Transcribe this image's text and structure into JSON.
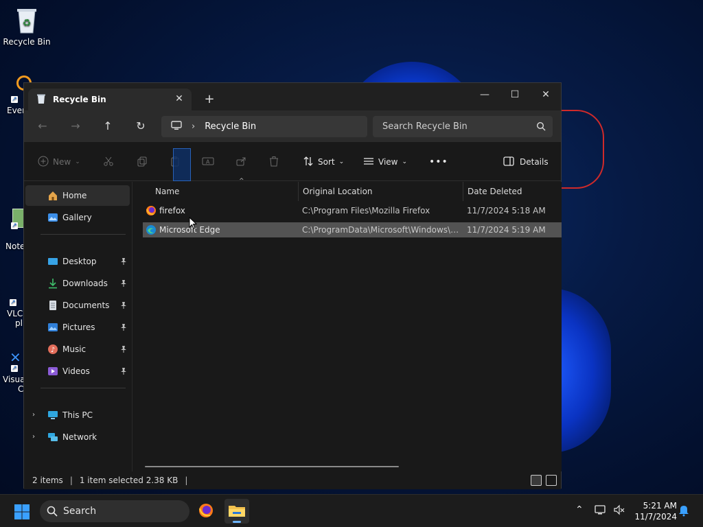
{
  "desktop": {
    "icons": [
      {
        "label": "Recycle Bin"
      },
      {
        "label": "Ever"
      },
      {
        "label": "Note"
      },
      {
        "label": "VLC"
      },
      {
        "label": "pl"
      },
      {
        "label": "Visua"
      },
      {
        "label": "C"
      }
    ]
  },
  "window": {
    "tab_title": "Recycle Bin",
    "new_tab_symbol": "+",
    "controls": {
      "minimize": "—",
      "maximize": "☐",
      "close": "✕"
    },
    "nav": {
      "back": "←",
      "forward": "→",
      "up": "↑",
      "refresh": "↻"
    },
    "address": {
      "location": "Recycle Bin"
    },
    "search": {
      "placeholder": "Search Recycle Bin"
    },
    "toolbar": {
      "new_label": "New",
      "sort_label": "Sort",
      "view_label": "View",
      "more_label": "•••",
      "details_label": "Details"
    },
    "sidebar": {
      "items": [
        {
          "label": "Home"
        },
        {
          "label": "Gallery"
        },
        {
          "label": "Desktop"
        },
        {
          "label": "Downloads"
        },
        {
          "label": "Documents"
        },
        {
          "label": "Pictures"
        },
        {
          "label": "Music"
        },
        {
          "label": "Videos"
        },
        {
          "label": "This PC"
        },
        {
          "label": "Network"
        }
      ]
    },
    "columns": {
      "name": "Name",
      "original_location": "Original Location",
      "date_deleted": "Date Deleted"
    },
    "rows": [
      {
        "name": "firefox",
        "location": "C:\\Program Files\\Mozilla Firefox",
        "date": "11/7/2024 5:18 AM"
      },
      {
        "name": "Microsoft Edge",
        "location": "C:\\ProgramData\\Microsoft\\Windows\\Sta...",
        "date": "11/7/2024 5:19 AM"
      }
    ],
    "status": {
      "count": "2 items",
      "selection": "1 item selected  2.38 KB"
    }
  },
  "taskbar": {
    "search_label": "Search",
    "clock_time": "5:21 AM",
    "clock_date": "11/7/2024"
  },
  "colors": {
    "accent": "#0078d4",
    "selection": "#535353",
    "scribble": "#d02a2a"
  }
}
